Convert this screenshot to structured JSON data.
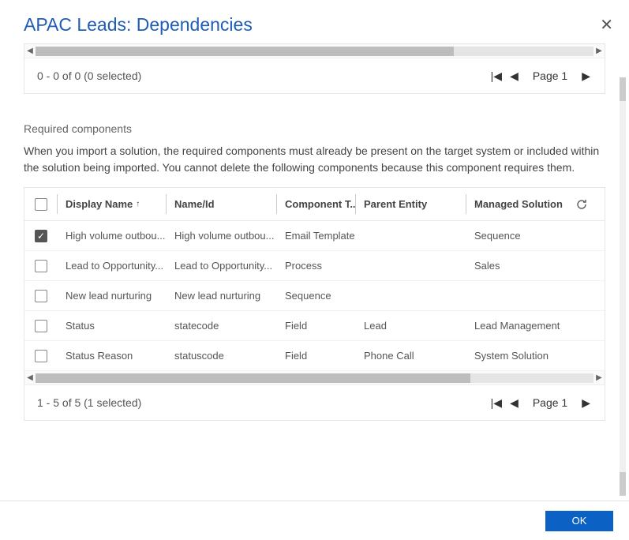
{
  "dialog": {
    "title": "APAC Leads: Dependencies",
    "ok_label": "OK"
  },
  "top_table": {
    "scroll_thumb_width_pct": 75,
    "pager": {
      "status": "0 - 0 of 0 (0 selected)",
      "page_label": "Page 1"
    }
  },
  "required": {
    "heading": "Required components",
    "description": "When you import a solution, the required components must already be present on the target system or included within the solution being imported. You cannot delete the following components because this component requires them.",
    "columns": {
      "display_name": "Display Name",
      "name_id": "Name/Id",
      "component_type": "Component T...",
      "parent_entity": "Parent Entity",
      "managed_solution": "Managed Solution"
    },
    "sort_indicator": "↑",
    "rows": [
      {
        "checked": true,
        "display_name": "High volume outbou...",
        "name_id": "High volume outbou...",
        "component_type": "Email Template",
        "parent_entity": "",
        "managed_solution": "Sequence"
      },
      {
        "checked": false,
        "display_name": "Lead to Opportunity...",
        "name_id": "Lead to Opportunity...",
        "component_type": "Process",
        "parent_entity": "",
        "managed_solution": "Sales"
      },
      {
        "checked": false,
        "display_name": "New lead nurturing",
        "name_id": "New lead nurturing",
        "component_type": "Sequence",
        "parent_entity": "",
        "managed_solution": ""
      },
      {
        "checked": false,
        "display_name": "Status",
        "name_id": "statecode",
        "component_type": "Field",
        "parent_entity": "Lead",
        "managed_solution": "Lead Management"
      },
      {
        "checked": false,
        "display_name": "Status Reason",
        "name_id": "statuscode",
        "component_type": "Field",
        "parent_entity": "Phone Call",
        "managed_solution": "System Solution"
      }
    ],
    "scroll_thumb_width_pct": 78,
    "pager": {
      "status": "1 - 5 of 5 (1 selected)",
      "page_label": "Page 1"
    }
  }
}
